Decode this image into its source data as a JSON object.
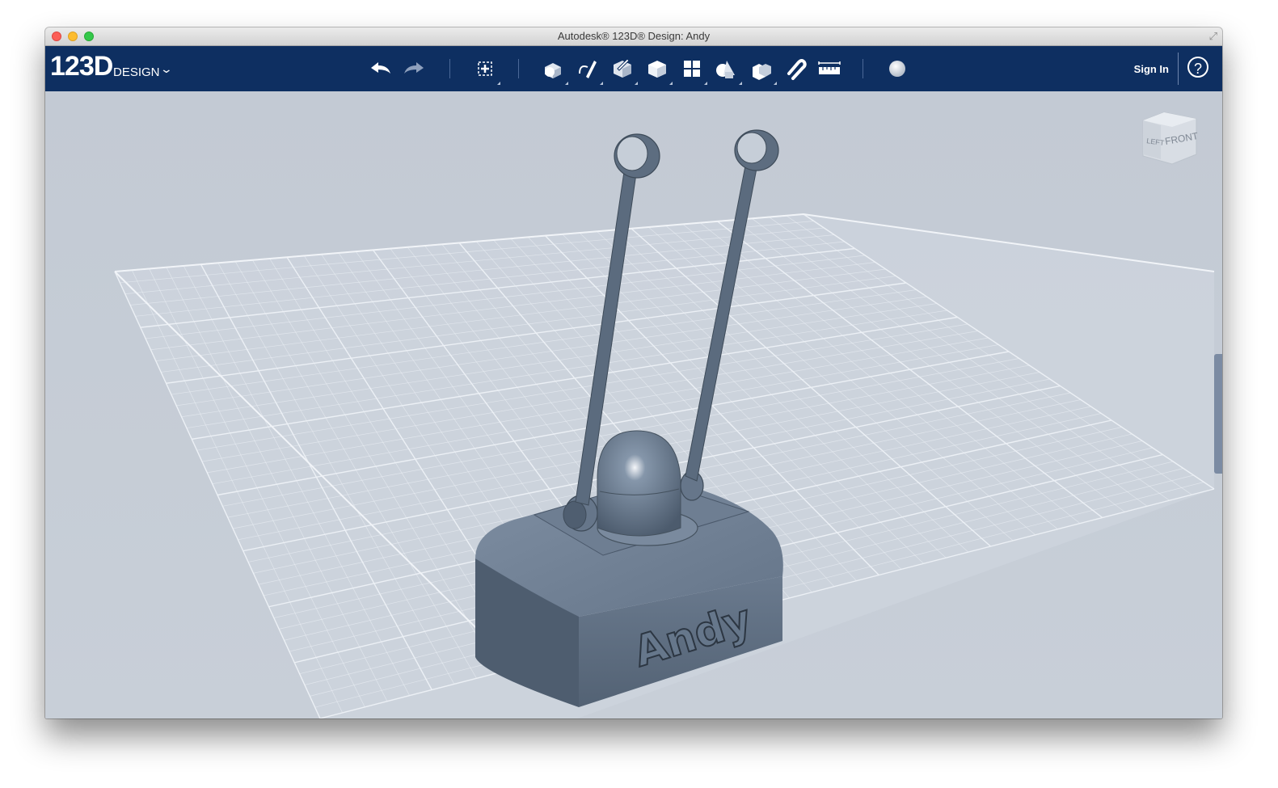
{
  "window": {
    "title": "Autodesk® 123D® Design: Andy"
  },
  "app": {
    "logo_main": "123D",
    "logo_sub": "DESIGN",
    "sign_in": "Sign In",
    "help_icon": "?"
  },
  "toolbar": {
    "tools": [
      "undo-icon",
      "redo-icon",
      "transform-icon",
      "primitives-icon",
      "sketch-icon",
      "construct-icon",
      "modify-icon",
      "pattern-icon",
      "grouping-icon",
      "combine-icon",
      "snap-icon",
      "measure-icon",
      "material-icon"
    ]
  },
  "viewcube": {
    "left_label": "LEFT",
    "front_label": "FRONT"
  },
  "model": {
    "engraved_text": "Andy",
    "color": "#5a6b80"
  },
  "colors": {
    "toolbar": "#0e2f61",
    "viewport": "#c5ccd6",
    "grid_line": "#e8edf3"
  }
}
